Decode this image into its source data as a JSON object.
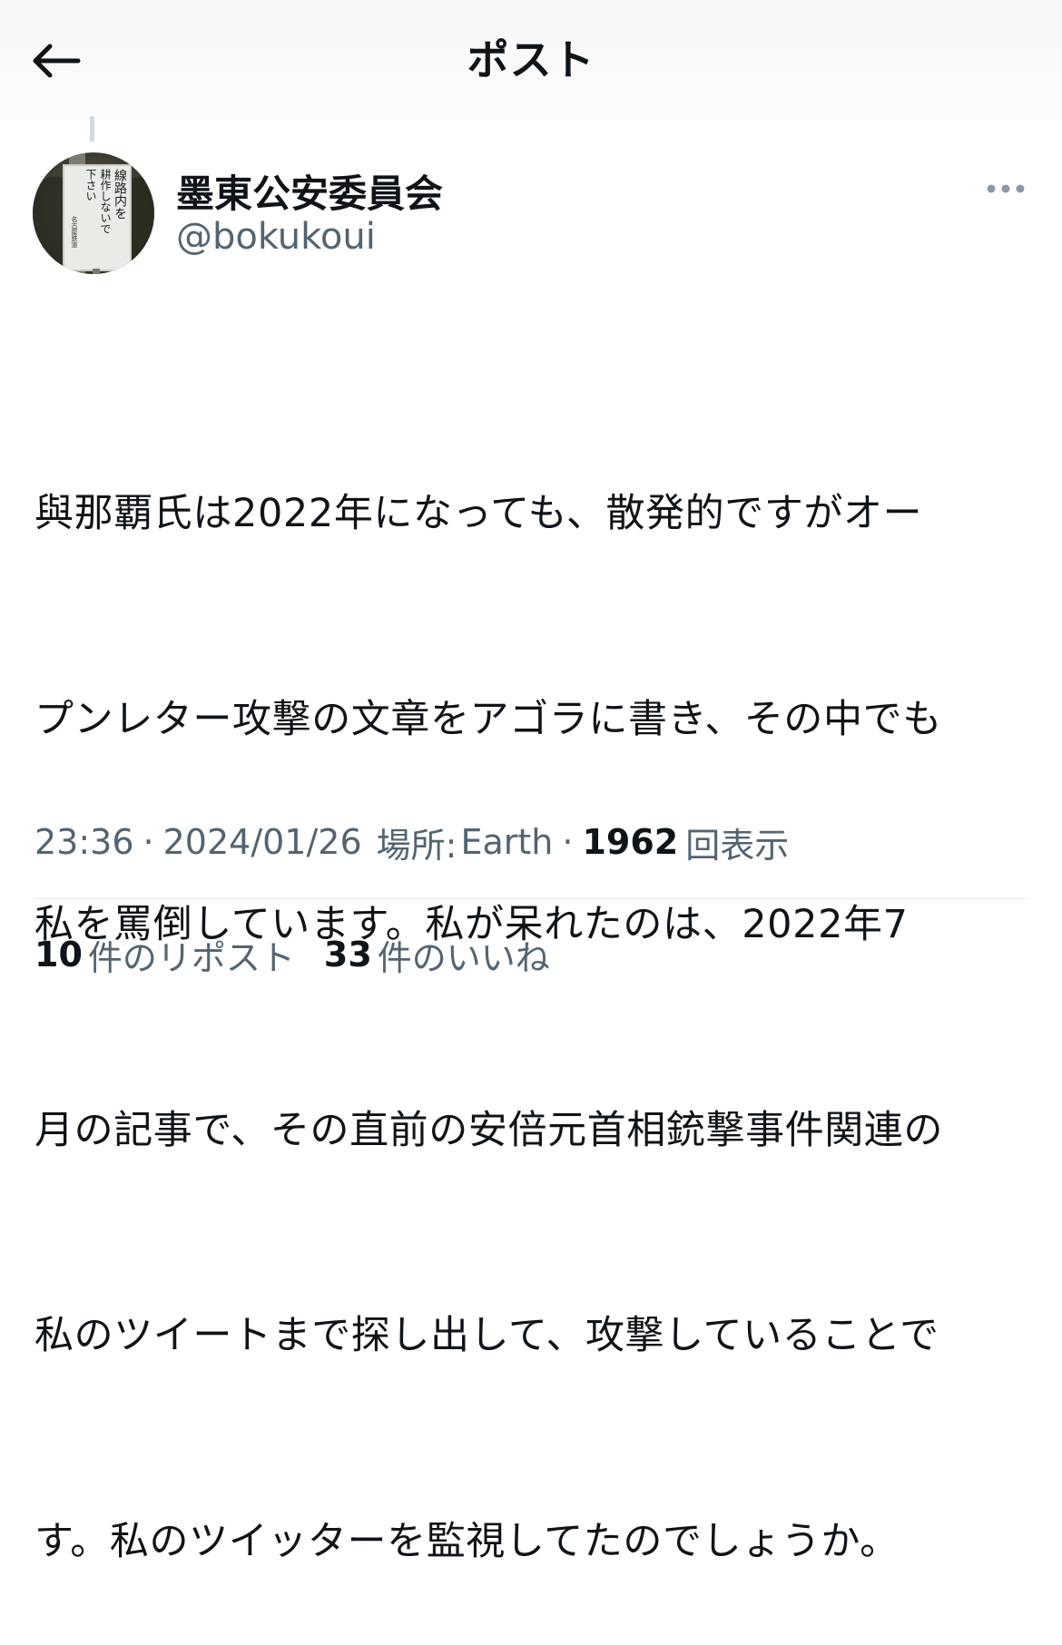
{
  "header": {
    "title": "ポスト",
    "back_icon": "arrow-left-icon"
  },
  "author": {
    "display_name": "墨東公安委員会",
    "handle": "@bokukoui",
    "avatar": {
      "icon": "avatar-signboard-image",
      "sign_lines": [
        "線路内を",
        "耕作しないで",
        "下さい"
      ],
      "sign_footer": "名古屋鉄道"
    },
    "more_icon": "more-horizontal-icon"
  },
  "post": {
    "text_lines": [
      "與那覇氏は2022年になっても、散発的ですがオー",
      "プンレター攻撃の文章をアゴラに書き、その中でも",
      "私を罵倒しています。私が呆れたのは、2022年7",
      "月の記事で、その直前の安倍元首相銃撃事件関連の",
      "私のツイートまで探し出して、攻撃していることで",
      "す。私のツイッターを監視してたのでしょうか。"
    ]
  },
  "meta": {
    "time": "23:36",
    "separator": "·",
    "date": "2024/01/26",
    "location_label": "場所:",
    "location_value": "Earth",
    "views_count": "1962",
    "views_label": "回表示"
  },
  "stats": {
    "reposts_count": "10",
    "reposts_label": "件のリポスト",
    "likes_count": "33",
    "likes_label": "件のいいね"
  },
  "colors": {
    "text_primary": "#0f1419",
    "text_secondary": "#536471",
    "divider": "#e6e9ec",
    "thread_line": "#cfd9de"
  }
}
